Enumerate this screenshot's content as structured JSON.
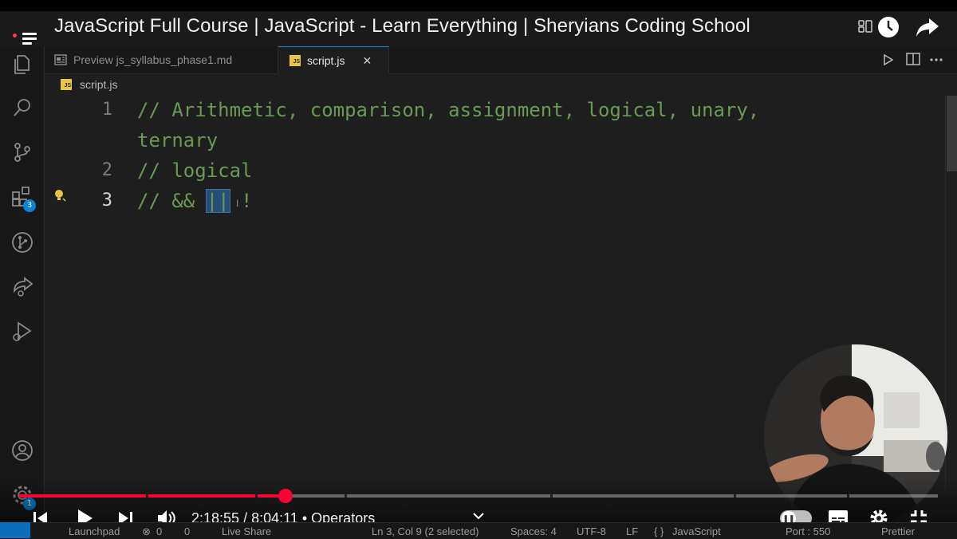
{
  "video": {
    "title": "JavaScript Full Course | JavaScript - Learn Everything | Sheryians Coding School",
    "time_current": "2:18:55",
    "time_separator": "/",
    "time_total": "8:04:11",
    "chapter": "• Operators",
    "progress_fraction": 0.29
  },
  "tabs": [
    {
      "label": "Preview js_syllabus_phase1.md",
      "icon": "preview-icon"
    },
    {
      "label": "script.js",
      "icon": "js-file-icon",
      "close": "✕",
      "js": "JS"
    }
  ],
  "breadcrumb": {
    "file": "script.js"
  },
  "editor": {
    "lines": [
      {
        "number": "1",
        "text": "// Arithmetic, comparison, assignment, logical, unary,"
      },
      {
        "number": "",
        "text": "ternary"
      },
      {
        "number": "2",
        "text": "// logical"
      },
      {
        "number": "3",
        "text_before": "// && ",
        "text_selected": "||",
        "text_after": " !"
      }
    ]
  },
  "activity_bar": {
    "extensions_badge": "3",
    "accounts_badge": "1"
  },
  "status_bar": {
    "launchpad": "Launchpad",
    "errors": "0",
    "warnings": "0",
    "live_share": "Live Share",
    "position": "Ln 3, Col 9 (2 selected)",
    "spaces": "Spaces: 4",
    "encoding": "UTF-8",
    "eol": "LF",
    "language": "JavaScript",
    "port": "Port : 550",
    "prettier": "Prettier"
  },
  "colors": {
    "accent": "#0a84d6",
    "comment": "#6a9955",
    "progress": "#ff0033"
  }
}
